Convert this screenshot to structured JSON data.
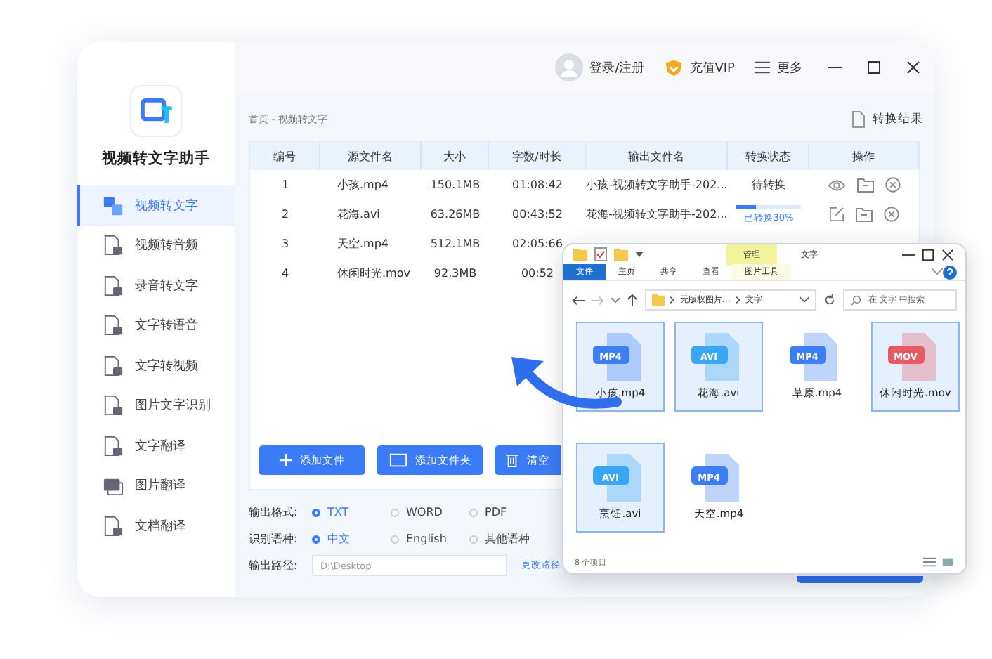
{
  "app": {
    "title": "视频转文字助手"
  },
  "topbar": {
    "login": "登录/注册",
    "vip": "充值VIP",
    "more": "更多"
  },
  "sidebar": {
    "items": [
      {
        "label": "视频转文字",
        "selected": true
      },
      {
        "label": "视频转音频",
        "selected": false
      },
      {
        "label": "录音转文字",
        "selected": false
      },
      {
        "label": "文字转语音",
        "selected": false
      },
      {
        "label": "文字转视频",
        "selected": false
      },
      {
        "label": "图片文字识别",
        "selected": false
      },
      {
        "label": "文字翻译",
        "selected": false
      },
      {
        "label": "图片翻译",
        "selected": false
      },
      {
        "label": "文档翻译",
        "selected": false
      }
    ]
  },
  "breadcrumb": "首页 - 视频转文字",
  "results_link": "转换结果",
  "table": {
    "columns": [
      "编号",
      "源文件名",
      "大小",
      "字数/时长",
      "输出文件名",
      "转换状态",
      "操作"
    ],
    "rows": [
      {
        "index": "1",
        "name": "小孩.mp4",
        "size": "150.1MB",
        "duration": "01:08:42",
        "output": "小孩-视频转文字助手-202...",
        "status": {
          "kind": "text",
          "text": "待转换"
        },
        "actions": [
          {
            "kind": "view"
          },
          {
            "kind": "folder"
          },
          {
            "kind": "delete"
          }
        ]
      },
      {
        "index": "2",
        "name": "花海.avi",
        "size": "63.26MB",
        "duration": "00:43:52",
        "output": "花海-视频转文字助手-202...",
        "status": {
          "kind": "progress",
          "level": 0.3,
          "text": "已转换30%"
        },
        "actions": [
          {
            "kind": "edit"
          },
          {
            "kind": "folder"
          },
          {
            "kind": "delete"
          }
        ]
      },
      {
        "index": "3",
        "name": "天空.mp4",
        "size": "512.1MB",
        "duration": "02:05:66"
      },
      {
        "index": "4",
        "name": "休闲时光.mov",
        "size": "92.3MB",
        "duration": "00:52"
      }
    ]
  },
  "buttons": [
    {
      "kind": "file",
      "label": "添加文件"
    },
    {
      "kind": "folder",
      "label": "添加文件夹"
    },
    {
      "kind": "clear",
      "label": "清空"
    }
  ],
  "format": {
    "label": "输出格式:",
    "options": [
      {
        "label": "TXT",
        "selected": true
      },
      {
        "label": "WORD",
        "selected": false
      },
      {
        "label": "PDF",
        "selected": false
      }
    ]
  },
  "language": {
    "label": "识别语种:",
    "options": [
      {
        "label": "中文",
        "selected": true
      },
      {
        "label": "English",
        "selected": false
      },
      {
        "label": "其他语种",
        "selected": false
      }
    ]
  },
  "output_path": {
    "label": "输出路径:",
    "value": "D:\\Desktop",
    "change": "更改路径"
  },
  "explorer": {
    "context_tab": "管理",
    "title": "文字",
    "ribbon": [
      {
        "label": "文件",
        "kind": "file"
      },
      {
        "label": "主页",
        "kind": "tab"
      },
      {
        "label": "共享",
        "kind": "tab"
      },
      {
        "label": "查看",
        "kind": "tab"
      },
      {
        "label": "图片工具",
        "kind": "context"
      }
    ],
    "path": [
      "无版权图片...",
      "文字"
    ],
    "search": {
      "placeholder": "在 文字 中搜索"
    },
    "files": [
      {
        "name": "小孩.mp4",
        "type": "MP4",
        "color": "#3d7ef2",
        "selected": true
      },
      {
        "name": "花海.avi",
        "type": "AVI",
        "color": "#3aa6f2",
        "selected": true
      },
      {
        "name": "草原.mp4",
        "type": "MP4",
        "color": "#3d7ef2",
        "selected": false
      },
      {
        "name": "休闲时光.mov",
        "type": "MOV",
        "color": "#e65a64",
        "selected": true
      },
      {
        "name": "烹饪.avi",
        "type": "AVI",
        "color": "#3aa6f2",
        "selected": true
      },
      {
        "name": "天空.mp4",
        "type": "MP4",
        "color": "#3d7ef2",
        "selected": false
      }
    ],
    "status": "8 个项目"
  }
}
